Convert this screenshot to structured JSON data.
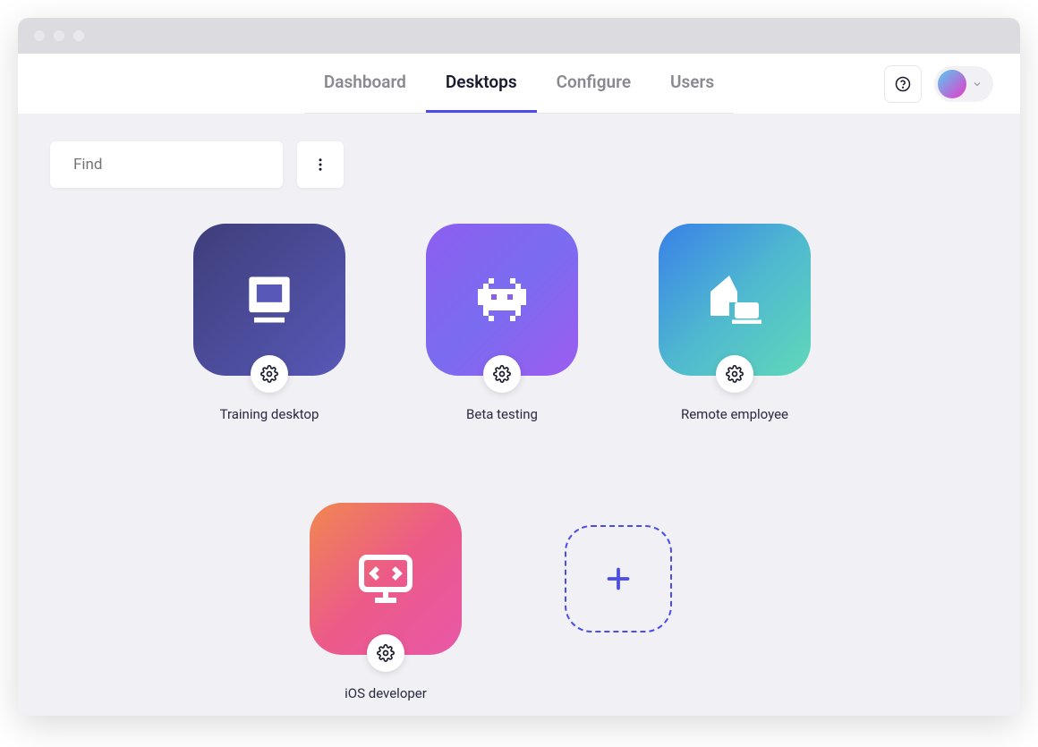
{
  "nav": {
    "tabs": [
      {
        "label": "Dashboard",
        "active": false
      },
      {
        "label": "Desktops",
        "active": true
      },
      {
        "label": "Configure",
        "active": false
      },
      {
        "label": "Users",
        "active": false
      }
    ]
  },
  "search": {
    "placeholder": "Find"
  },
  "desktops": [
    {
      "label": "Training desktop",
      "tile": "training",
      "icon": "computer-icon"
    },
    {
      "label": "Beta testing",
      "tile": "beta",
      "icon": "invader-icon"
    },
    {
      "label": "Remote employee",
      "tile": "remote",
      "icon": "home-laptop-icon"
    },
    {
      "label": "iOS developer",
      "tile": "ios",
      "icon": "code-monitor-icon"
    }
  ],
  "icons": {
    "help": "help-icon",
    "more": "more-vertical-icon",
    "gear": "gear-icon",
    "plus": "plus-icon",
    "search": "search-icon",
    "chevron": "chevron-down-icon"
  }
}
